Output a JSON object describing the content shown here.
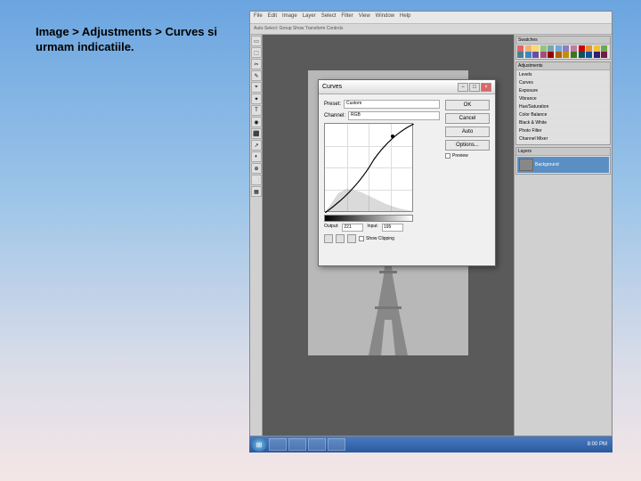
{
  "instruction": "Image > Adjustments > Curves si urmam indicatiile.",
  "menubar": [
    "File",
    "Edit",
    "Image",
    "Layer",
    "Select",
    "Filter",
    "View",
    "Window",
    "Help"
  ],
  "options_bar": "Auto-Select: Group   Show Transform Controls",
  "tools": [
    "▭",
    "⬚",
    "✂",
    "✎",
    "⌖",
    "✦",
    "T",
    "◉",
    "⬛",
    "↗",
    "◐",
    "⊕",
    "⬜",
    "▦"
  ],
  "panels": {
    "swatches": {
      "title": "Swatches"
    },
    "adjustments": {
      "title": "Adjustments",
      "items": [
        "Levels",
        "Curves",
        "Exposure",
        "Vibrance",
        "Hue/Saturation",
        "Color Balance",
        "Black & White",
        "Photo Filter",
        "Channel Mixer"
      ]
    },
    "layers": {
      "title": "Layers",
      "layer_name": "Background"
    }
  },
  "curves": {
    "title": "Curves",
    "preset_label": "Preset:",
    "preset_value": "Custom",
    "channel_label": "Channel:",
    "channel_value": "RGB",
    "output_label": "Output:",
    "output_value": "221",
    "input_label": "Input:",
    "input_value": "195",
    "ok": "OK",
    "cancel": "Cancel",
    "auto": "Auto",
    "options": "Options...",
    "preview": "Preview",
    "show_clipping": "Show Clipping"
  },
  "swatch_colors": [
    "#e06666",
    "#f6b26b",
    "#ffd966",
    "#93c47d",
    "#76a5af",
    "#6fa8dc",
    "#8e7cc3",
    "#c27ba0",
    "#cc0000",
    "#e69138",
    "#f1c232",
    "#6aa84f",
    "#45818e",
    "#3d85c6",
    "#674ea7",
    "#a64d79",
    "#990000",
    "#b45f06",
    "#bf9000",
    "#38761d",
    "#134f5c",
    "#0b5394",
    "#351c75",
    "#741b47"
  ],
  "taskbar": {
    "time": "8:00 PM"
  }
}
